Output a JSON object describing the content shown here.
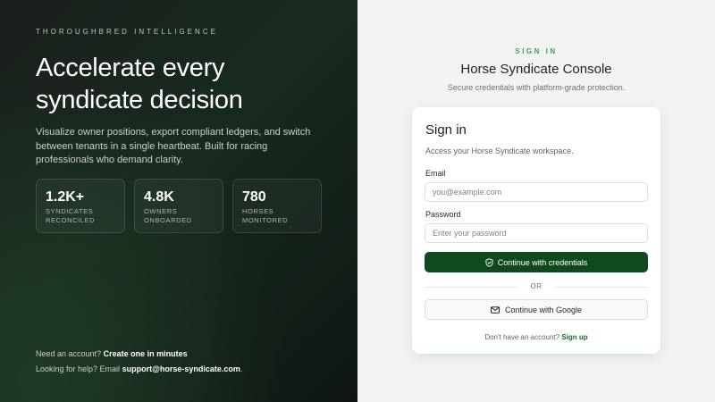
{
  "hero": {
    "eyebrow": "THOROUGHBRED INTELLIGENCE",
    "title": "Accelerate every syndicate decision",
    "description": "Visualize owner positions, export compliant ledgers, and switch between tenants in a single heartbeat. Built for racing professionals who demand clarity.",
    "stats": [
      {
        "value": "1.2K+",
        "label_line1": "SYNDICATES",
        "label_line2": "RECONCILED"
      },
      {
        "value": "4.8K",
        "label_line1": "OWNERS",
        "label_line2": "ONBOARDED"
      },
      {
        "value": "780",
        "label_line1": "HORSES",
        "label_line2": "MONITORED"
      }
    ],
    "account_prompt": "Need an account?",
    "account_link": "Create one in minutes",
    "help_prompt": "Looking for help? Email",
    "help_email": "support@horse-syndicate.com",
    "help_suffix": "."
  },
  "auth": {
    "kicker": "SIGN IN",
    "title": "Horse Syndicate Console",
    "subtitle": "Secure credentials with platform-grade protection.",
    "card": {
      "title": "Sign in",
      "subtitle": "Access your Horse Syndicate workspace.",
      "email_label": "Email",
      "email_placeholder": "you@example.com",
      "email_value": "",
      "password_label": "Password",
      "password_placeholder": "Enter your password",
      "password_value": "",
      "primary_button": "Continue with credentials",
      "divider": "OR",
      "google_button": "Continue with Google",
      "signup_prompt": "Don't have an account?",
      "signup_link": "Sign up"
    }
  },
  "colors": {
    "accent": "#0f4a1f",
    "kicker": "#3f9a66",
    "link": "#166a33"
  },
  "icons": {
    "primary_button_icon": "shield-check-icon",
    "google_button_icon": "mail-icon"
  }
}
